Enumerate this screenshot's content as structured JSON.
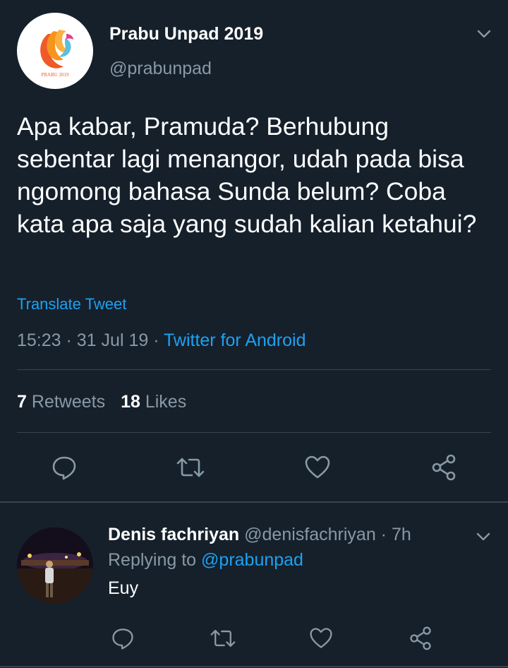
{
  "tweet": {
    "display_name": "Prabu Unpad 2019",
    "handle": "@prabunpad",
    "avatar_logo_text": "PRABU 2019",
    "text": "Apa kabar, Pramuda? Berhubung sebentar lagi menangor, udah pada bisa ngomong bahasa Sunda belum? Coba kata apa saja yang sudah kalian ketahui?",
    "translate_label": "Translate Tweet",
    "time": "15:23",
    "date": "31 Jul 19",
    "client": "Twitter for Android",
    "separator": " · ",
    "retweets_count": "7",
    "retweets_label": "Retweets",
    "likes_count": "18",
    "likes_label": "Likes"
  },
  "reply": {
    "display_name": "Denis fachriyan",
    "handle": "@denisfachriyan",
    "age": "7h",
    "replying_prefix": "Replying to",
    "replying_to": "@prabunpad",
    "text": "Euy"
  },
  "icons": {
    "reply": "speech-bubble-icon",
    "retweet": "retweet-icon",
    "like": "heart-icon",
    "share": "share-icon",
    "menu": "chevron-down-icon"
  },
  "colors": {
    "background": "#15202b",
    "accent": "#1da1f2",
    "muted": "#8899a6",
    "divider": "#38444d"
  }
}
